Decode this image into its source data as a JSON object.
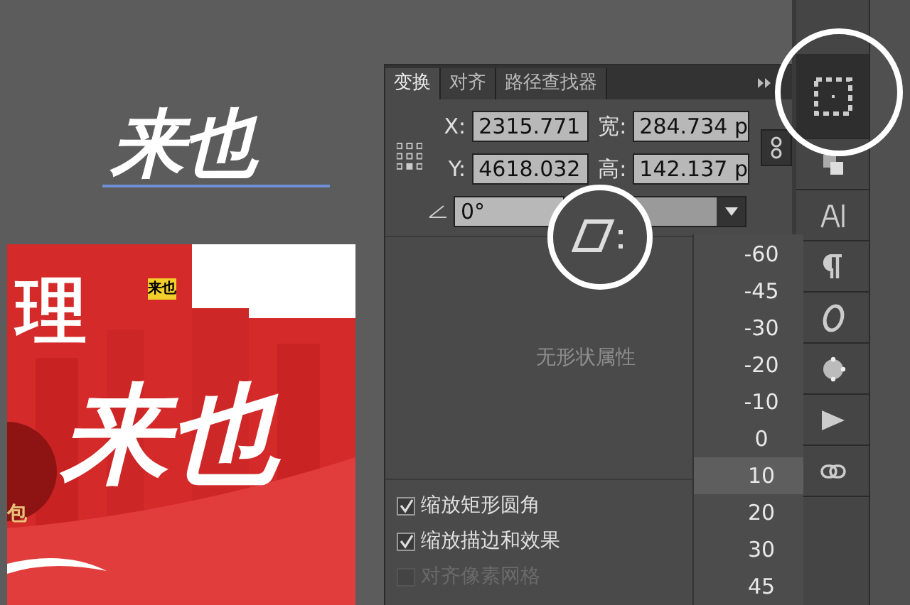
{
  "canvas": {
    "title_art": "来也",
    "banner": {
      "char": "理",
      "badge": "来也",
      "headline": "来也",
      "circle_text": "包"
    }
  },
  "panel": {
    "tabs": [
      {
        "label": "变换",
        "selected": true
      },
      {
        "label": "对齐",
        "selected": false
      },
      {
        "label": "路径查找器",
        "selected": false
      }
    ],
    "fields": [
      {
        "label": "X:",
        "value": "2315.771"
      },
      {
        "label": "宽:",
        "value": "284.734 p"
      },
      {
        "label": "Y:",
        "value": "4618.032"
      },
      {
        "label": "高:",
        "value": "142.137 p"
      }
    ],
    "angle": {
      "value": "0°"
    },
    "empty_message": "无形状属性",
    "options": [
      {
        "label": "缩放矩形圆角",
        "checked": true,
        "disabled": false
      },
      {
        "label": "缩放描边和效果",
        "checked": true,
        "disabled": false
      },
      {
        "label": "对齐像素网格",
        "checked": false,
        "disabled": true
      }
    ],
    "dropdown": {
      "items": [
        {
          "label": "-60",
          "selected": false
        },
        {
          "label": "-45",
          "selected": false
        },
        {
          "label": "-30",
          "selected": false
        },
        {
          "label": "-20",
          "selected": false
        },
        {
          "label": "-10",
          "selected": false
        },
        {
          "label": "0",
          "selected": false
        },
        {
          "label": "10",
          "selected": true
        },
        {
          "label": "20",
          "selected": false
        },
        {
          "label": "30",
          "selected": false
        },
        {
          "label": "45",
          "selected": false
        }
      ]
    }
  }
}
